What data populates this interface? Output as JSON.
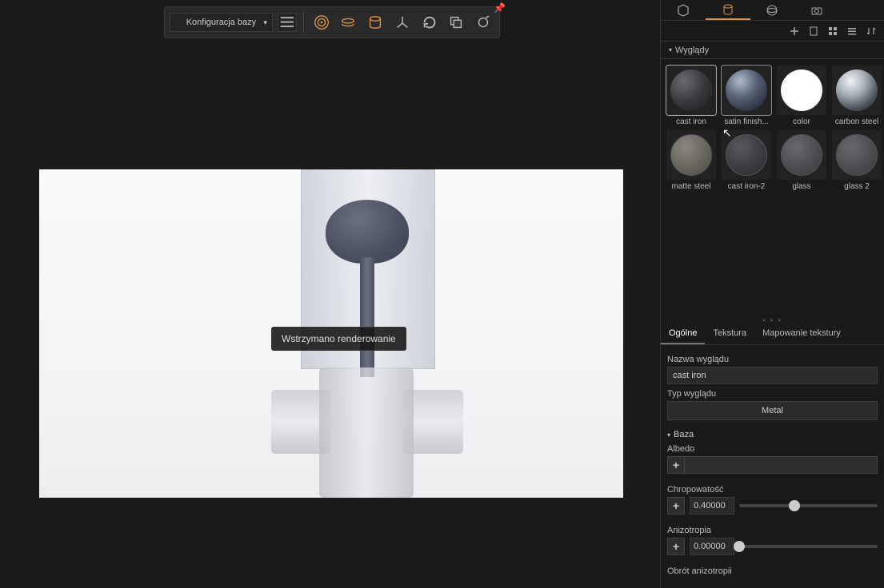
{
  "toolbar": {
    "config_label": "Konfiguracja bazy"
  },
  "viewport": {
    "status": "Wstrzymano renderowanie"
  },
  "panel": {
    "section_title": "Wyglądy",
    "materials": [
      {
        "name": "cast iron",
        "css": "mat-castiron",
        "selected": true
      },
      {
        "name": "satin finish...",
        "css": "mat-satin",
        "highlighted": true
      },
      {
        "name": "color",
        "css": "mat-color"
      },
      {
        "name": "carbon steel",
        "css": "mat-carbonsteel"
      },
      {
        "name": "matte steel",
        "css": "mat-mattesteel"
      },
      {
        "name": "cast iron-2",
        "css": "mat-castiron2"
      },
      {
        "name": "glass",
        "css": "mat-glass"
      },
      {
        "name": "glass 2",
        "css": "mat-glass2"
      }
    ],
    "prop_tabs": {
      "general": "Ogólne",
      "texture": "Tekstura",
      "mapping": "Mapowanie tekstury"
    },
    "labels": {
      "name": "Nazwa wyglądu",
      "type": "Typ wyglądu",
      "base": "Baza",
      "albedo": "Albedo",
      "roughness": "Chropowatość",
      "anisotropy": "Anizotropia",
      "aniso_rot": "Obrót anizotropii"
    },
    "values": {
      "name": "cast iron",
      "type": "Metal",
      "roughness": "0.40000",
      "anisotropy": "0.00000"
    },
    "sliders": {
      "roughness_pct": 40,
      "anisotropy_pct": 0
    }
  }
}
